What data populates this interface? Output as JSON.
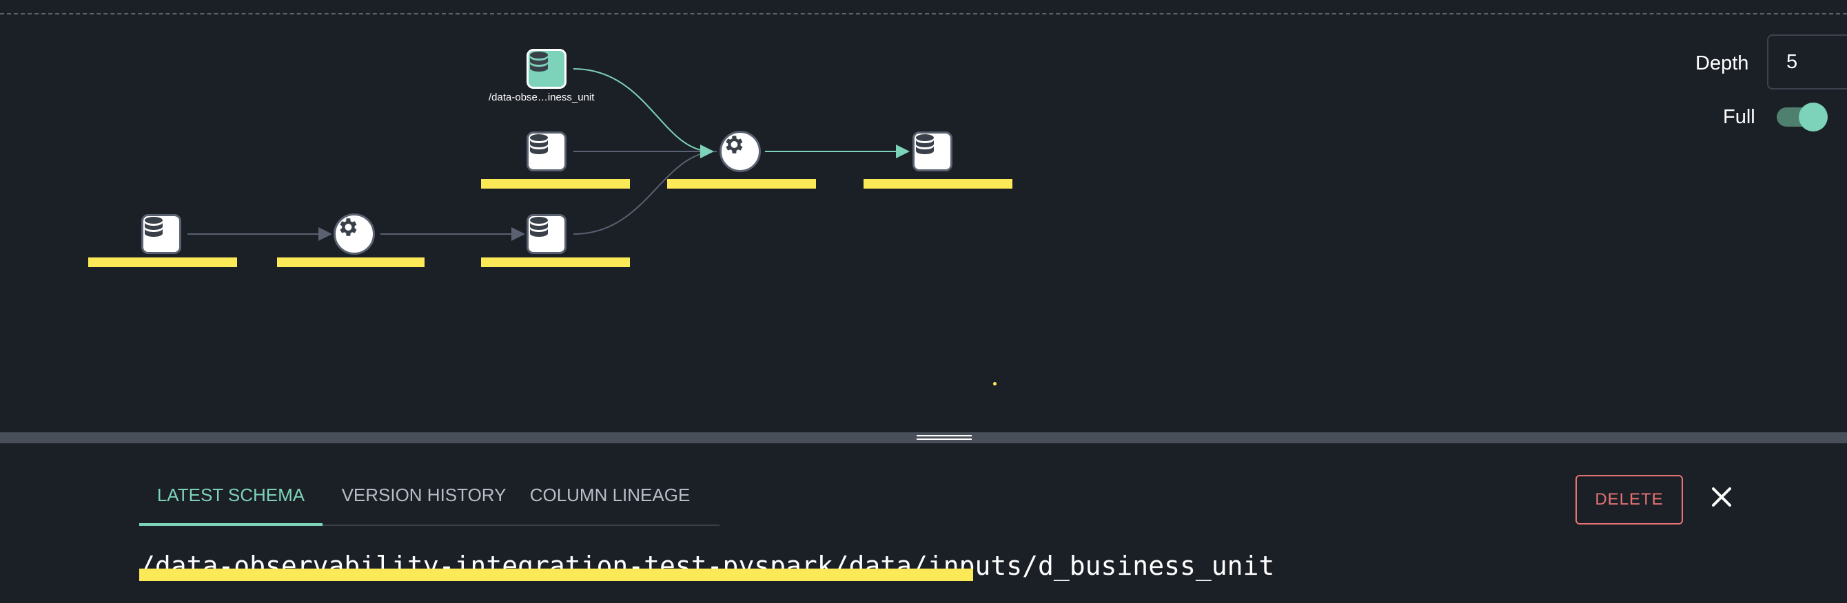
{
  "graph": {
    "nodes": [
      {
        "id": "src1",
        "kind": "dataset",
        "label": "",
        "redacted": true
      },
      {
        "id": "job1",
        "kind": "job",
        "label": "",
        "redacted": true
      },
      {
        "id": "ds2",
        "kind": "dataset",
        "label": "",
        "redacted": true
      },
      {
        "id": "ds_selected",
        "kind": "dataset",
        "label": "/data-obse…iness_unit",
        "redacted": false,
        "selected": true
      },
      {
        "id": "ds3",
        "kind": "dataset",
        "label": "",
        "redacted": true
      },
      {
        "id": "job2",
        "kind": "job",
        "label": "",
        "redacted": true
      },
      {
        "id": "out1",
        "kind": "dataset",
        "label": "",
        "redacted": true
      }
    ]
  },
  "controls": {
    "depth_label": "Depth",
    "depth_value": "5",
    "full_label": "Full",
    "full_enabled": true
  },
  "panel": {
    "tabs": [
      {
        "label": "LATEST SCHEMA",
        "active": true
      },
      {
        "label": "VERSION HISTORY",
        "active": false
      },
      {
        "label": "COLUMN LINEAGE",
        "active": false
      }
    ],
    "delete_label": "DELETE",
    "dataset_path": "/data-observability-integration-test-pyspark/data/inputs/d_business_unit"
  },
  "colors": {
    "background": "#1b1f26",
    "accent": "#7dd3b9",
    "danger": "#e57373",
    "redaction": "#fbe957"
  },
  "icons": [
    "database-icon",
    "gear-icon",
    "close-icon"
  ]
}
